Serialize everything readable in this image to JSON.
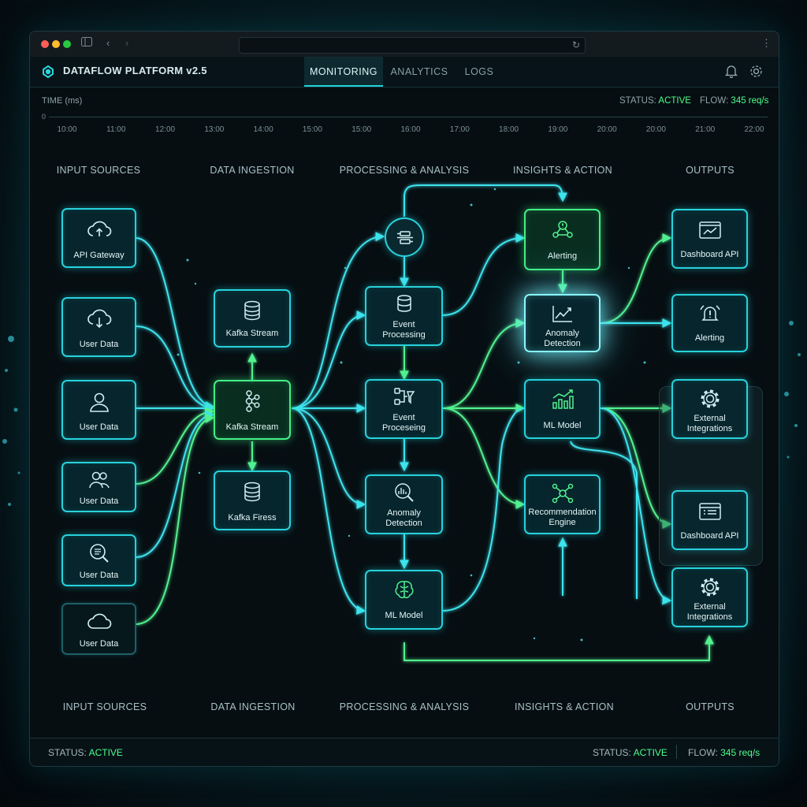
{
  "app": {
    "title": "DATAFLOW PLATFORM v2.5"
  },
  "tabs": [
    {
      "label": "MONITORING"
    },
    {
      "label": "ANALYTICS"
    },
    {
      "label": "LOGS"
    }
  ],
  "timeline": {
    "axis_label": "TIME (ms)",
    "origin": "0",
    "ticks": [
      "10:00",
      "11:00",
      "12:00",
      "13:00",
      "14:00",
      "15:00",
      "15:00",
      "16:00",
      "17:00",
      "18:00",
      "19:00",
      "20:00",
      "20:00",
      "21:00",
      "22:00"
    ],
    "status_label": "STATUS:",
    "status_value": "ACTIVE",
    "flow_label": "FLOW:",
    "flow_value": "345 req/s"
  },
  "columns_top": [
    "INPUT SOURCES",
    "DATA INGESTION",
    "PROCESSING & ANALYSIS",
    "INSIGHTS & ACTION",
    "OUTPUTS"
  ],
  "columns_bottom": [
    "INPUT SOURCES",
    "DATA INGESTION",
    "PROCESSING & ANALYSIS",
    "INSIGHTS & ACTION",
    "OUTPUTS"
  ],
  "nodes": {
    "api_gateway": "API Gateway",
    "user_data_1": "User Data",
    "user_data_2": "User Data",
    "user_data_3": "User Data",
    "user_data_4": "User Data",
    "user_data_5": "User Data",
    "kafka_stream_top": "Kafka Stream",
    "kafka_stream_main": "Kafka Stream",
    "kafka_firess": "Kafka Firess",
    "event_processing_1": [
      "Event",
      "Processing"
    ],
    "event_processing_2": [
      "Event",
      "Proceseing"
    ],
    "anomaly_detection_proc": [
      "Anomaly",
      "Detection"
    ],
    "ml_model_proc": "ML Model",
    "alerting_insight": "Alerting",
    "anomaly_detection_insight": [
      "Anomaly",
      "Detection"
    ],
    "ml_model_insight": "ML Model",
    "recommendation_engine": [
      "Recommendation",
      "Engine"
    ],
    "dashboard_api_1": "Dashboard API",
    "alerting_output": "Alerting",
    "external_integrations_1": [
      "External",
      "Integrations"
    ],
    "dashboard_api_2": "Dashboard API",
    "external_integrations_2": [
      "External",
      "Integrations"
    ]
  },
  "footer": {
    "status_label": "STATUS:",
    "status_value": "ACTIVE",
    "status_right_label": "STATUS:",
    "status_right_value": "ACTIVE",
    "flow_label": "FLOW:",
    "flow_value": "345 req/s"
  },
  "colors": {
    "accent": "#27d2dc",
    "active": "#4dff8a",
    "background": "#060e12"
  }
}
